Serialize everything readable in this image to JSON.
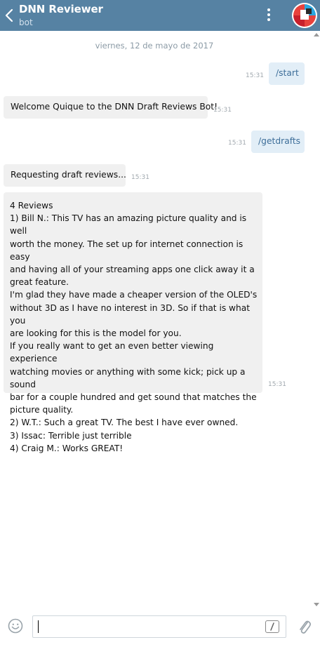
{
  "header": {
    "title": "DNN Reviewer",
    "subtitle": "bot",
    "back_icon": "chevron-left-icon",
    "menu_icon": "kebab-menu-icon",
    "background_color": "#5682a3"
  },
  "messages": {
    "date_divider": "viernes, 12 de mayo de 2017",
    "items": [
      {
        "direction": "out",
        "text": "/start",
        "time": "15:31"
      },
      {
        "direction": "in",
        "text": "Welcome Quique to the DNN Draft Reviews Bot!",
        "time": "15:31"
      },
      {
        "direction": "out",
        "text": "/getdrafts",
        "time": "15:31"
      },
      {
        "direction": "in",
        "text": "Requesting draft reviews...",
        "time": "15:31"
      },
      {
        "direction": "in",
        "text": "4 Reviews\n1) Bill N.: This TV has an amazing picture quality and is well\nworth the money. The set up for internet connection is easy\nand having all of your streaming apps one click away it a\ngreat feature.\nI'm glad they have made a cheaper version of the OLED's\nwithout 3D as I have no interest in 3D. So if that is what you\nare looking for this is the model for you.\nIf you really want to get an even better viewing experience\nwatching movies or anything with some kick; pick up a sound\nbar for a couple hundred and get sound that matches the\npicture quality.\n2) W.T.: Such a great TV. The best I have ever owned.\n3) Issac: Terrible just terrible\n4) Craig M.: Works GREAT!",
        "time": "15:31"
      }
    ]
  },
  "composer": {
    "input_value": "",
    "emoji_icon": "emoji-smile-icon",
    "command_icon": "slash-command-icon",
    "attach_icon": "paperclip-icon"
  }
}
